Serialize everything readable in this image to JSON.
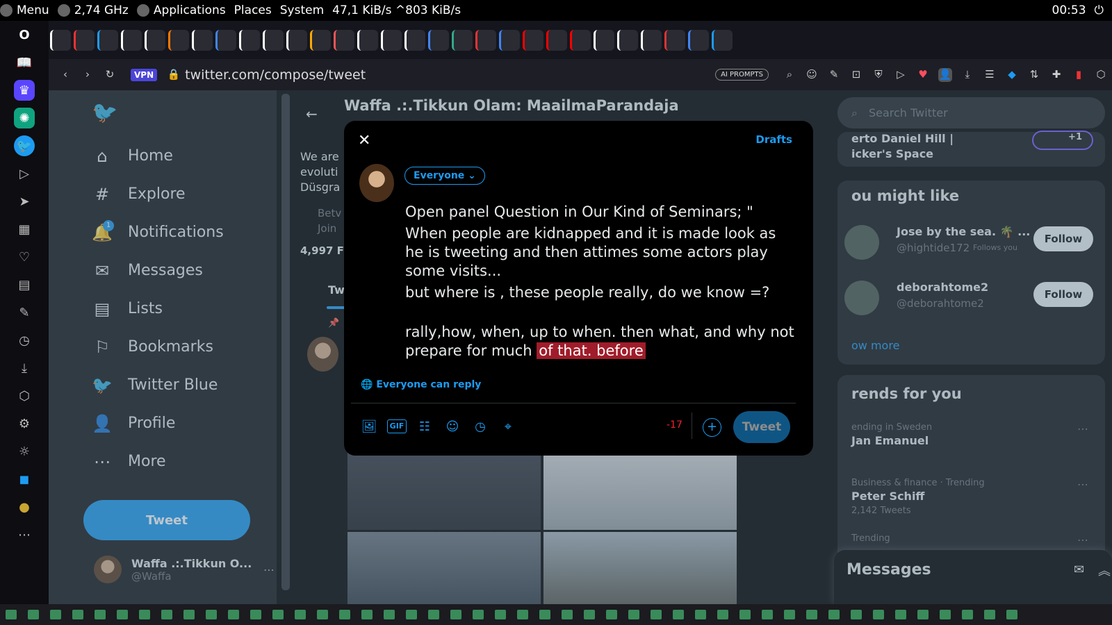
{
  "topbar": {
    "menu": "Menu",
    "cpu": "2,74 GHz",
    "applications": "Applications",
    "places": "Places",
    "system": "System",
    "net": "47,1 KiB/s ^803 KiB/s",
    "clock": "00:53"
  },
  "tabs": [
    "",
    "",
    "",
    "",
    "",
    "",
    "",
    "",
    "",
    "",
    "",
    "",
    "",
    "",
    "",
    "",
    "",
    "",
    "",
    "",
    "",
    "",
    "",
    "",
    "",
    "",
    "",
    "",
    ""
  ],
  "address": {
    "vpn": "VPN",
    "url": "twitter.com/compose/tweet",
    "ai": "AI PROMPTS"
  },
  "nav": {
    "items": [
      {
        "label": "Home",
        "icon": "home-icon"
      },
      {
        "label": "Explore",
        "icon": "hashtag-icon"
      },
      {
        "label": "Notifications",
        "icon": "bell-icon",
        "badge": "1"
      },
      {
        "label": "Messages",
        "icon": "mail-icon"
      },
      {
        "label": "Lists",
        "icon": "list-icon"
      },
      {
        "label": "Bookmarks",
        "icon": "bookmark-icon"
      },
      {
        "label": "Twitter Blue",
        "icon": "twitter-blue-icon"
      },
      {
        "label": "Profile",
        "icon": "person-icon"
      },
      {
        "label": "More",
        "icon": "more-icon"
      }
    ],
    "tweet": "Tweet",
    "user_name": "Waffa .:.Tikkun O...",
    "user_handle": "@Waffa"
  },
  "center": {
    "title": "Waffa .:.Tikkun Olam: MaailmaParandaja",
    "bio1": "We are",
    "bio2": "evoluti",
    "bio3": "Düsgra",
    "loc": "Betv",
    "joined": "Join",
    "followers": "4,997 F",
    "tab": "Tw"
  },
  "right": {
    "search_placeholder": "Search Twitter",
    "space_line": "erto Daniel Hill |",
    "space_line2": "icker's Space",
    "plus": "+1",
    "yml": "ou might like",
    "suggest": [
      {
        "name": "Jose by the sea. 🌴 ...",
        "handle": "@hightide172",
        "tag": "Follows you",
        "btn": "Follow"
      },
      {
        "name": "deborahtome2",
        "handle": "@deborahtome2",
        "tag": "",
        "btn": "Follow"
      }
    ],
    "show_more": "ow more",
    "trends_title": "rends for you",
    "trends": [
      {
        "meta": "ending in Sweden",
        "name": "Jan Emanuel",
        "count": ""
      },
      {
        "meta": "Business & finance · Trending",
        "name": "Peter Schiff",
        "count": "2,142 Tweets"
      },
      {
        "meta": "Trending",
        "name": "",
        "count": ""
      }
    ],
    "messages": "Messages"
  },
  "modal": {
    "drafts": "Drafts",
    "audience": "Everyone",
    "line1": "Open panel Question in Our Kind of Seminars; \"",
    "line2": "When people are kidnapped and it is made look as he is tweeting and then attimes some actors play some visits...",
    "line3": "but where is , these people really, do we know =?",
    "line4_main": "rally,how, when, up to when. then what, and why not prepare for much",
    "line4_over": "of that. before",
    "reply": "Everyone can reply",
    "counter": "-17",
    "tweet": "Tweet"
  }
}
